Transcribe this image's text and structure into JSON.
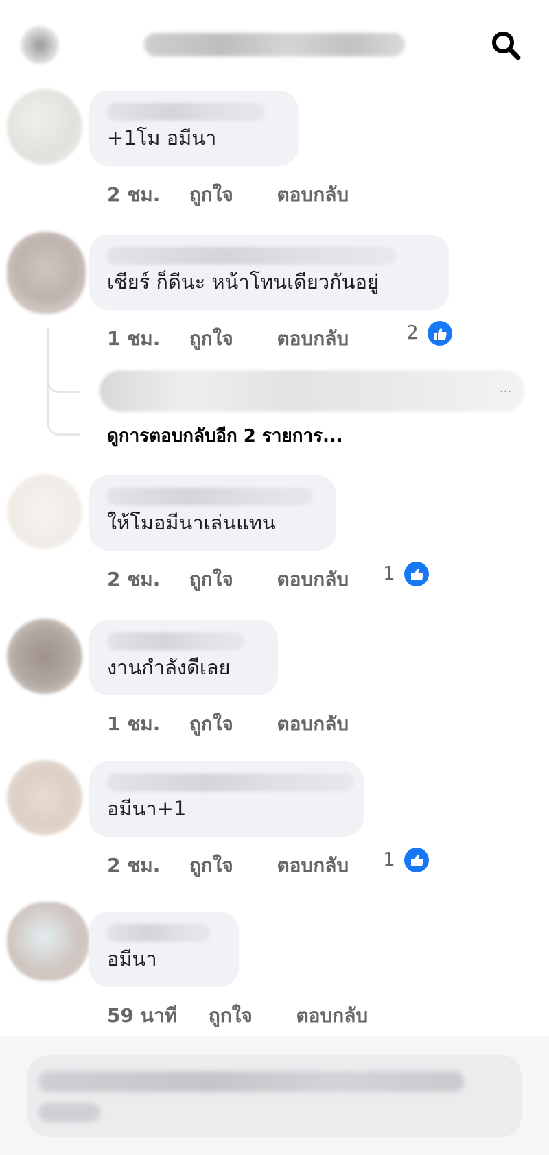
{
  "header": {
    "back_icon": "back-arrow-icon",
    "search_icon": "search-icon"
  },
  "comments": [
    {
      "text": "+1โม อมีนา",
      "time": "2 ชม.",
      "like_label": "ถูกใจ",
      "reply_label": "ตอบกลับ",
      "likes": ""
    },
    {
      "text": "เชียร์ ก็ดีนะ หน้าโทนเดียวกันอยู่",
      "time": "1 ชม.",
      "like_label": "ถูกใจ",
      "reply_label": "ตอบกลับ",
      "likes": "2"
    },
    {
      "text": "ให้โมอมีนาเล่นแทน",
      "time": "2 ชม.",
      "like_label": "ถูกใจ",
      "reply_label": "ตอบกลับ",
      "likes": "1"
    },
    {
      "text": "งานกำลังดีเลย",
      "time": "1 ชม.",
      "like_label": "ถูกใจ",
      "reply_label": "ตอบกลับ",
      "likes": ""
    },
    {
      "text": "อมีนา+1",
      "time": "2 ชม.",
      "like_label": "ถูกใจ",
      "reply_label": "ตอบกลับ",
      "likes": "1"
    },
    {
      "text": "อมีนา",
      "time": "59 นาที",
      "like_label": "ถูกใจ",
      "reply_label": "ตอบกลับ",
      "likes": ""
    }
  ],
  "replies": {
    "ellipsis": "...",
    "view_more": "ดูการตอบกลับอีก 2 รายการ..."
  },
  "colors": {
    "like_blue": "#1877f2",
    "bubble_bg": "#f0f2f5",
    "meta_gray": "#65676b"
  }
}
